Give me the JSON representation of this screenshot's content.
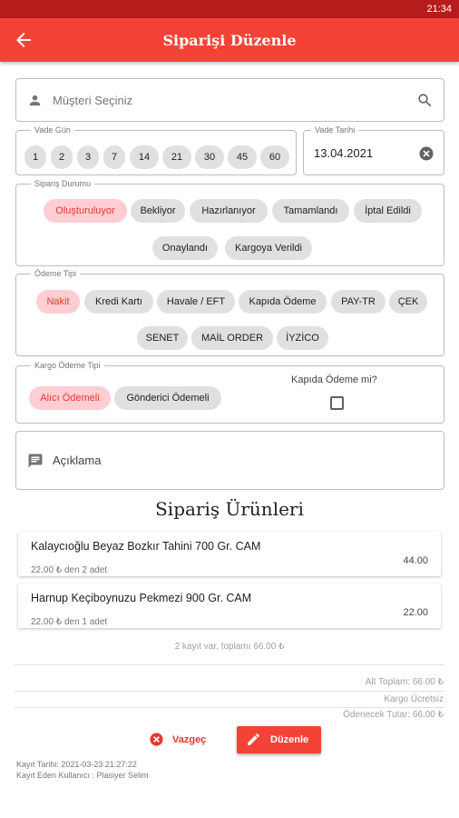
{
  "status_bar": {
    "time": "21:34"
  },
  "appbar": {
    "title": "Siparişi Düzenle"
  },
  "customer": {
    "placeholder": "Müşteri Seçiniz"
  },
  "vade_gun": {
    "legend": "Vade Gün",
    "options": [
      "1",
      "2",
      "3",
      "7",
      "14",
      "21",
      "30",
      "45",
      "60"
    ]
  },
  "vade_tarihi": {
    "legend": "Vade Tarihi",
    "value": "13.04.2021"
  },
  "siparis_durumu": {
    "legend": "Sipariş Durumu",
    "selected": "Oluşturuluyor",
    "options": [
      "Oluşturuluyor",
      "Bekliyor",
      "Hazırlanıyor",
      "Tamamlandı",
      "İptal Edildi",
      "Onaylandı",
      "Kargoya Verildi"
    ]
  },
  "odeme_tipi": {
    "legend": "Ödeme Tipi",
    "selected": "Nakit",
    "options": [
      "Nakit",
      "Kredi Kartı",
      "Havale / EFT",
      "Kapıda Ödeme",
      "PAY-TR",
      "ÇEK",
      "SENET",
      "MAİL ORDER",
      "İYZİCO"
    ]
  },
  "kargo_odeme_tipi": {
    "legend": "Kargo Ödeme Tipi",
    "selected": "Alıcı Ödemeli",
    "options": [
      "Alıcı Ödemeli",
      "Gönderici Ödemeli"
    ],
    "cod_label": "Kapıda Ödeme mi?",
    "cod_checked": false
  },
  "aciklama": {
    "placeholder": "Açıklama"
  },
  "products_title": "Sipariş Ürünleri",
  "products": [
    {
      "name": "Kalaycıoğlu Beyaz Bozkır Tahini 700 Gr. CAM",
      "detail": "22.00 ₺ den 2 adet",
      "total": "44.00"
    },
    {
      "name": "Harnup Keçiboynuzu Pekmezi 900 Gr. CAM",
      "detail": "22.00 ₺ den 1 adet",
      "total": "22.00"
    }
  ],
  "summary": "2 kayıt var, toplamı 66.00 ₺",
  "totals": {
    "alt_toplam": "Alt Toplam: 66.00 ₺",
    "kargo": "Kargo Ücretsiz",
    "odenecek": "Ödenecek Tutar: 66.00 ₺"
  },
  "actions": {
    "cancel": "Vazgeç",
    "submit": "Düzenle"
  },
  "footer": {
    "kayit_tarihi": "Kayıt Tarihi: 2021-03-23 21:27:22",
    "kayit_eden": "Kayıt Eden Kullanıcı : Plasiyer Selim"
  },
  "colors": {
    "primary": "#f44336",
    "primary_dark": "#b71c1c",
    "chip_selected_bg": "#ffcdd2",
    "chip_selected_text": "#e53935",
    "chip_bg": "#e0e0e0"
  }
}
